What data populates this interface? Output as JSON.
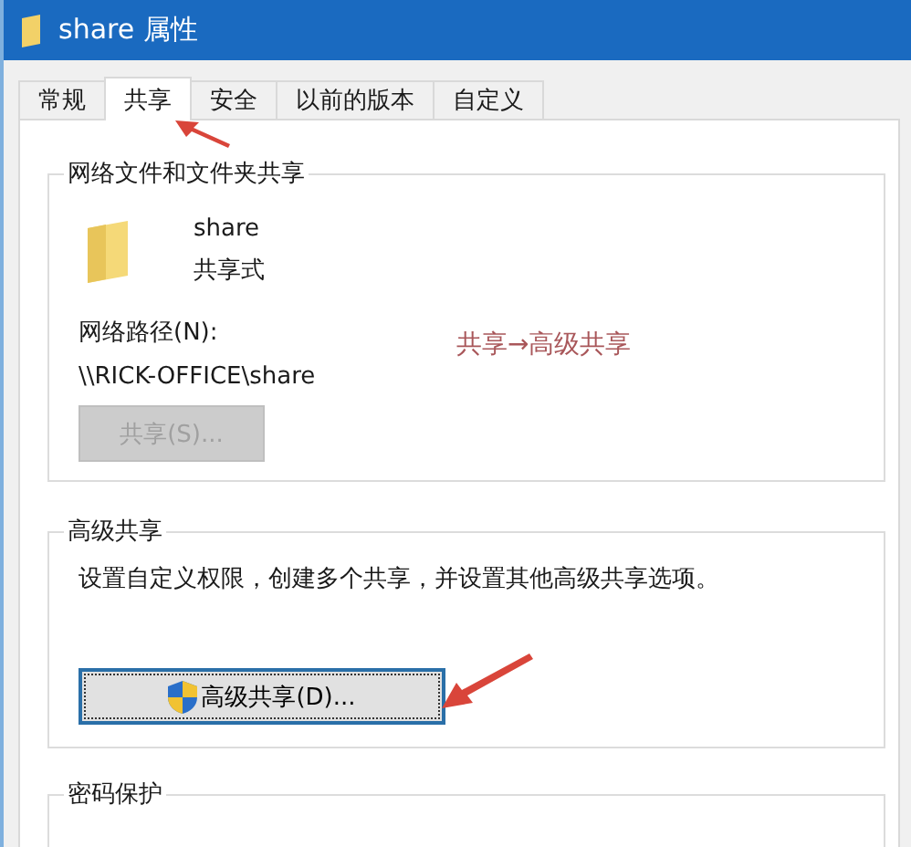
{
  "window": {
    "title": "share 属性"
  },
  "tabs": [
    {
      "label": "常规",
      "selected": false
    },
    {
      "label": "共享",
      "selected": true
    },
    {
      "label": "安全",
      "selected": false
    },
    {
      "label": "以前的版本",
      "selected": false
    },
    {
      "label": "自定义",
      "selected": false
    }
  ],
  "network_sharing": {
    "title": "网络文件和文件夹共享",
    "folder_name": "share",
    "share_status": "共享式",
    "path_label": "网络路径(N):",
    "path": "\\\\RICK-OFFICE\\share",
    "share_button": {
      "label": "共享(S)...",
      "disabled": true
    }
  },
  "advanced_sharing": {
    "title": "高级共享",
    "description": "设置自定义权限，创建多个共享，并设置其他高级共享选项。",
    "button": {
      "label": "高级共享(D)...",
      "focused": true
    }
  },
  "password_protection": {
    "title": "密码保护"
  },
  "annotation": {
    "text": "共享→高级共享"
  }
}
